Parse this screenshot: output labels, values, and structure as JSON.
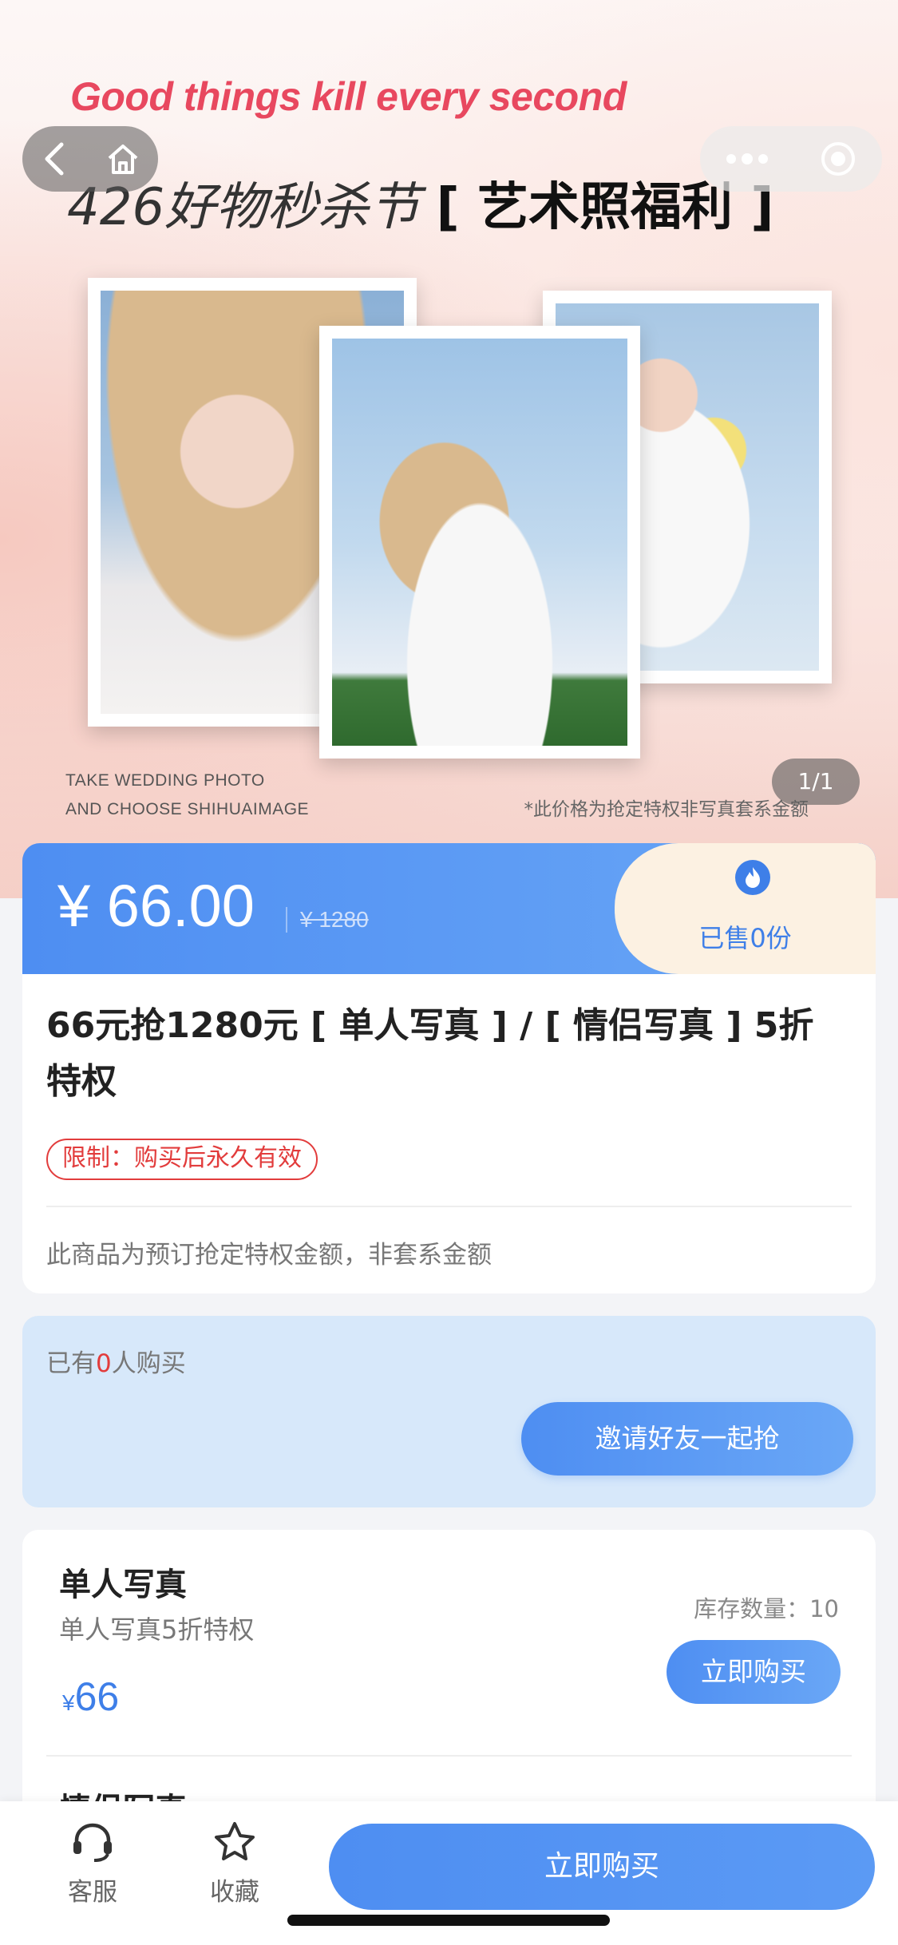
{
  "hero": {
    "tagline": "Good things kill every second",
    "title_light": "426好物秒杀节",
    "title_bold": "[ 艺术照福利 ]",
    "caption_line1": "TAKE WEDDING PHOTO",
    "caption_line2": "AND CHOOSE SHIHUAIMAGE",
    "note": "*此价格为抢定特权非写真套系金额",
    "pager": "1/1"
  },
  "nav": {
    "back_icon": "chevron-left-icon",
    "home_icon": "home-icon",
    "more_icon": "more-dots-icon",
    "close_icon": "target-circle-icon"
  },
  "price": {
    "current": "¥ 66.00",
    "original": "¥ 1280",
    "sold": "已售0份",
    "sold_icon": "flame-icon"
  },
  "info": {
    "title": "66元抢1280元 [ 单人写真 ] / [ 情侣写真 ] 5折特权",
    "limit": "限制：购买后永久有效",
    "desc": "此商品为预订抢定特权金额，非套系金额"
  },
  "buyers": {
    "prefix": "已有",
    "count": "0",
    "suffix": "人购买",
    "invite": "邀请好友一起抢"
  },
  "package": {
    "name": "单人写真",
    "sub": "单人写真5折特权",
    "currency": "¥",
    "price": "66",
    "stock": "库存数量：10",
    "buy": "立即购买",
    "next_name": "情侣写真"
  },
  "bottom": {
    "service": "客服",
    "favorite": "收藏",
    "buy": "立即购买"
  },
  "colors": {
    "accent": "#4e8ef2",
    "tagline": "#e8485f",
    "warning": "#e23c3c",
    "sold_bg": "#fcf1e2"
  }
}
